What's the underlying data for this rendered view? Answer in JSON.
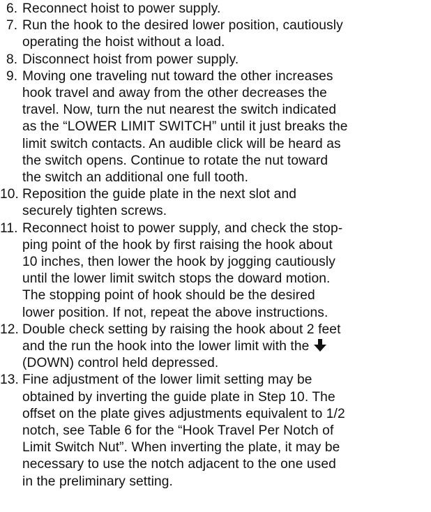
{
  "steps": [
    {
      "number": "6.",
      "text": "Reconnect hoist to power supply."
    },
    {
      "number": "7.",
      "lines": [
        "Run the hook to the desired lower position, cautiously",
        "operating the hoist without a load."
      ]
    },
    {
      "number": "8.",
      "text": "Disconnect hoist from power supply."
    },
    {
      "number": "9.",
      "lines": [
        "Moving one traveling nut toward the other increases",
        "hook travel and away from the other decreases the",
        "travel. Now, turn the nut nearest the switch indicated",
        "as the “LOWER LIMIT SWITCH” until it just breaks the",
        "limit switch contacts. An audible click will be heard as",
        "the switch opens. Continue to rotate the nut toward",
        "the switch an additional one full tooth."
      ]
    },
    {
      "number": "10.",
      "lines": [
        "Reposition the guide plate in the next slot and",
        "securely tighten screws."
      ]
    },
    {
      "number": "11.",
      "lines": [
        "Reconnect hoist to power supply, and check the stop-",
        "ping point of the hook by first raising the hook about",
        "10 inches, then lower the hook by jogging cautiously",
        "until the lower limit switch stops the doward motion.",
        "The stopping point of hook should be the desired",
        "lower position. If not, repeat the above instructions."
      ]
    },
    {
      "number": "12.",
      "line1": "Double check setting by raising the hook about 2 feet",
      "line2": "and the run the hook into the lower limit with the",
      "arrow_icon": "down-arrow-icon",
      "line3": "(DOWN) control held depressed."
    },
    {
      "number": "13.",
      "lines": [
        "Fine adjustment of the lower limit setting may be",
        "obtained by inverting the guide plate in Step 10. The",
        "offset on the plate gives adjustments equivalent to 1/2",
        "notch, see Table 6 for the “Hook Travel Per Notch of",
        "Limit Switch Nut”. When inverting the plate, it may be",
        "necessary to use the notch adjacent to the one used",
        "in the preliminary setting."
      ]
    }
  ]
}
